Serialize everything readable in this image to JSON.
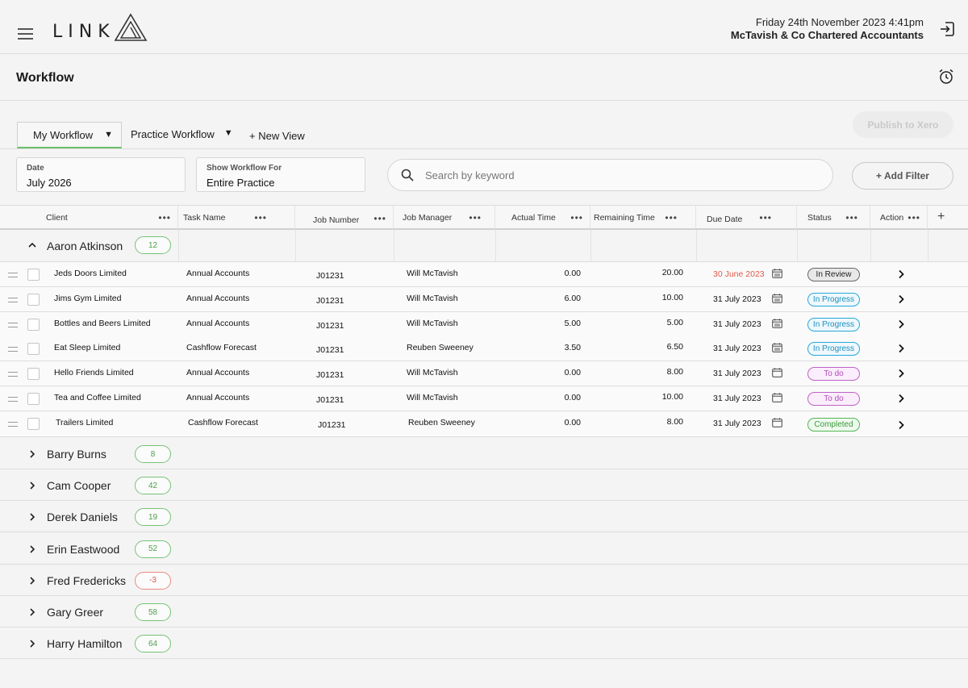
{
  "header": {
    "logo_text": "LINK",
    "datetime": "Friday 24th November 2023  4:41pm",
    "firm": "McTavish & Co Chartered Accountants"
  },
  "page": {
    "title": "Workflow"
  },
  "tabs": {
    "my_workflow": "My Workflow",
    "practice_workflow": "Practice Workflow",
    "new_view": "+ New View",
    "caret": "▼"
  },
  "publish_button": "Publish to Xero",
  "filters": {
    "date_label": "Date",
    "date_value": "July 2026",
    "scope_label": "Show Workflow For",
    "scope_value": "Entire Practice",
    "search_placeholder": "Search by keyword",
    "add_filter": "+ Add Filter"
  },
  "columns": {
    "client": "Client",
    "task": "Task Name",
    "job_number": "Job Number",
    "job_manager": "Job Manager",
    "actual": "Actual Time",
    "remaining": "Remaining Time",
    "due": "Due Date",
    "status": "Status",
    "action": "Action",
    "dots": "•••",
    "add_col": "+"
  },
  "expanded_group": {
    "name": "Aaron Atkinson",
    "count": "12"
  },
  "rows": [
    {
      "client": "Jeds Doors Limited",
      "task": "Annual Accounts",
      "job": "J01231",
      "manager": "Will McTavish",
      "actual": "0.00",
      "remaining": "20.00",
      "due": "30 June 2023",
      "status": "In Review"
    },
    {
      "client": "Jims Gym Limited",
      "task": "Annual Accounts",
      "job": "J01231",
      "manager": "Will McTavish",
      "actual": "6.00",
      "remaining": "10.00",
      "due": "31 July 2023",
      "status": "In Progress"
    },
    {
      "client": "Bottles and Beers Limited",
      "task": "Annual Accounts",
      "job": "J01231",
      "manager": "Will McTavish",
      "actual": "5.00",
      "remaining": "5.00",
      "due": "31 July 2023",
      "status": "In Progress"
    },
    {
      "client": "Eat Sleep Limited",
      "task": "Cashflow Forecast",
      "job": "J01231",
      "manager": "Reuben Sweeney",
      "actual": "3.50",
      "remaining": "6.50",
      "due": "31 July 2023",
      "status": "In Progress"
    },
    {
      "client": "Hello Friends Limited",
      "task": "Annual Accounts",
      "job": "J01231",
      "manager": "Will McTavish",
      "actual": "0.00",
      "remaining": "8.00",
      "due": "31 July 2023",
      "status": "To do"
    },
    {
      "client": "Tea and Coffee Limited",
      "task": "Annual Accounts",
      "job": "J01231",
      "manager": "Will McTavish",
      "actual": "0.00",
      "remaining": "10.00",
      "due": "31 July 2023",
      "status": "To do"
    },
    {
      "client": "Trailers Limited",
      "task": "Cashflow Forecast",
      "job": "J01231",
      "manager": "Reuben Sweeney",
      "actual": "0.00",
      "remaining": "8.00",
      "due": "31 July 2023",
      "status": "Completed"
    }
  ],
  "groups": [
    {
      "name": "Barry Burns",
      "count": "8"
    },
    {
      "name": "Cam Cooper",
      "count": "42"
    },
    {
      "name": "Derek Daniels",
      "count": "19"
    },
    {
      "name": "Erin Eastwood",
      "count": "52"
    },
    {
      "name": "Fred Fredericks",
      "count": "-3"
    },
    {
      "name": "Gary Greer",
      "count": "58"
    },
    {
      "name": "Harry Hamilton",
      "count": "64"
    }
  ],
  "colors": {
    "accent_green": "#6cbf6a",
    "overdue_red": "#e05b4b",
    "status_review": "#666666",
    "status_progress": "#29a8d9",
    "status_todo": "#c062c6",
    "status_completed": "#54b553"
  },
  "icons": {
    "menu": "hamburger-icon",
    "logout": "logout-icon",
    "alarm": "alarm-clock-icon",
    "search": "search-icon",
    "calendar": "calendar-icon",
    "chevron": "chevron-icon",
    "drag": "drag-handle-icon"
  }
}
